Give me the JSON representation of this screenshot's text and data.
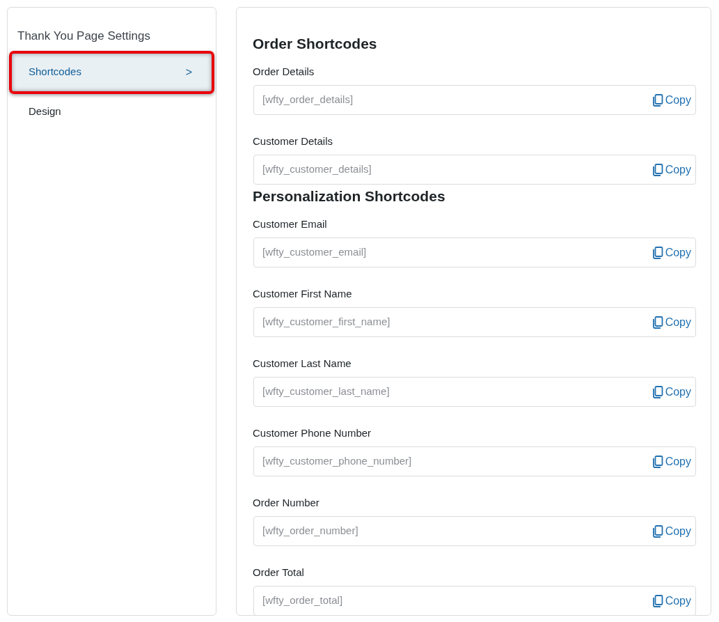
{
  "sidebar": {
    "title": "Thank You Page Settings",
    "items": [
      {
        "label": "Shortcodes",
        "selected": true,
        "highlighted": true,
        "chevron": ">"
      },
      {
        "label": "Design",
        "selected": false,
        "highlighted": false
      }
    ]
  },
  "sections": [
    {
      "heading": "Order Shortcodes",
      "fields": [
        {
          "label": "Order Details",
          "value": "[wfty_order_details]",
          "button": "Copy"
        },
        {
          "label": "Customer Details",
          "value": "[wfty_customer_details]",
          "button": "Copy"
        }
      ]
    },
    {
      "heading": "Personalization Shortcodes",
      "fields": [
        {
          "label": "Customer Email",
          "value": "[wfty_customer_email]",
          "button": "Copy"
        },
        {
          "label": "Customer First Name",
          "value": "[wfty_customer_first_name]",
          "button": "Copy"
        },
        {
          "label": "Customer Last Name",
          "value": "[wfty_customer_last_name]",
          "button": "Copy"
        },
        {
          "label": "Customer Phone Number",
          "value": "[wfty_customer_phone_number]",
          "button": "Copy"
        },
        {
          "label": "Order Number",
          "value": "[wfty_order_number]",
          "button": "Copy"
        },
        {
          "label": "Order Total",
          "value": "[wfty_order_total]",
          "button": "Copy"
        }
      ]
    }
  ]
}
